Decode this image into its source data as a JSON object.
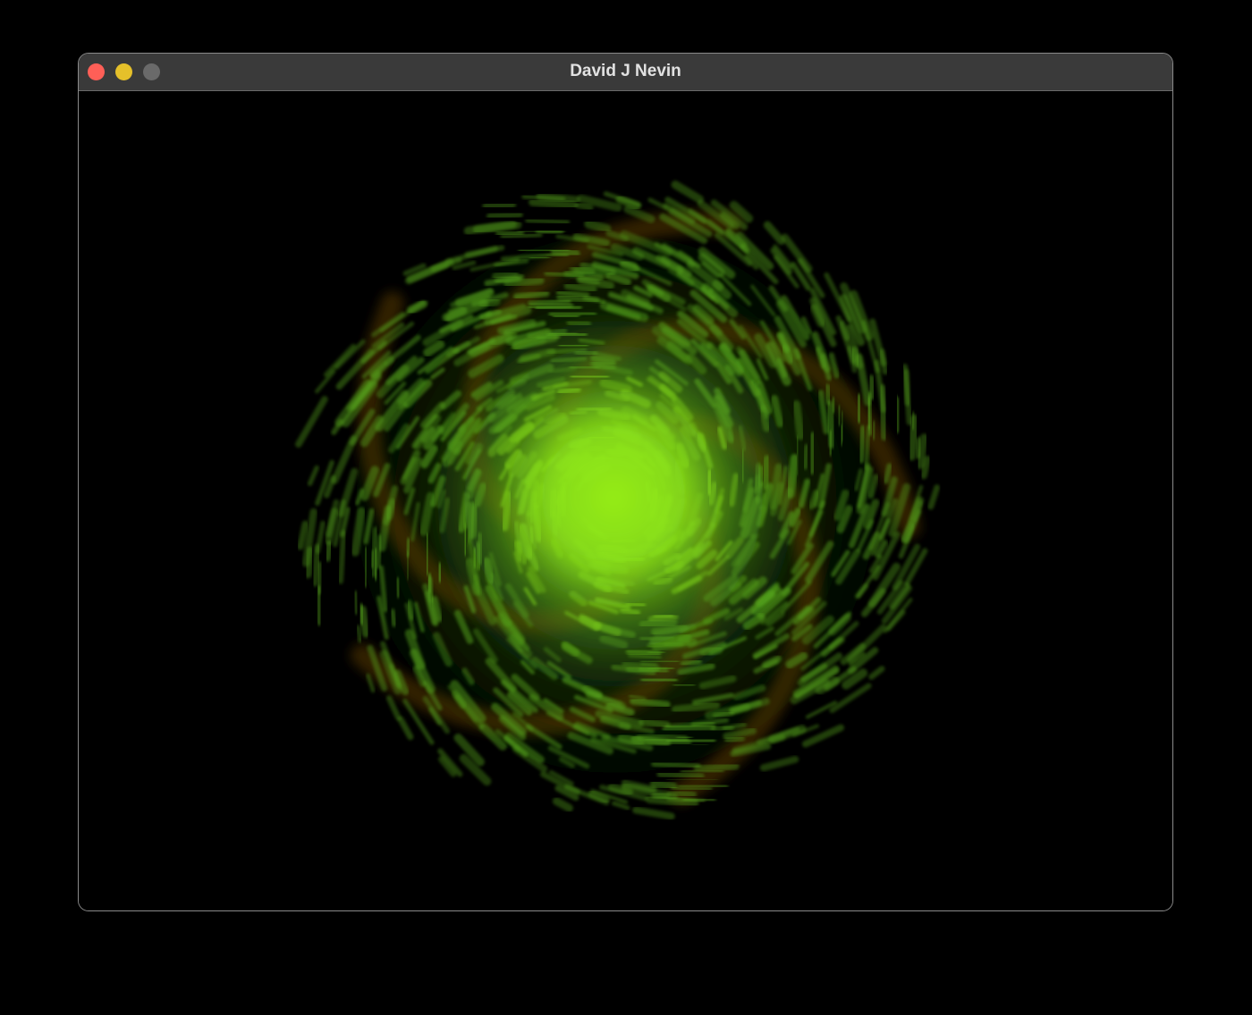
{
  "window": {
    "title": "David J Nevin",
    "buttons": {
      "close": {
        "name": "close",
        "color": "#ff5f57"
      },
      "minimize": {
        "name": "minimize",
        "color": "#e5c02a"
      },
      "zoom": {
        "name": "zoom",
        "color": "#6a6a6a"
      }
    }
  },
  "canvas": {
    "background": "#000000",
    "graphic": "green-spiral-galaxy",
    "core_color": "#8fe81a",
    "arm_color": "#56a41c",
    "dust_color": "#5a3a05"
  }
}
